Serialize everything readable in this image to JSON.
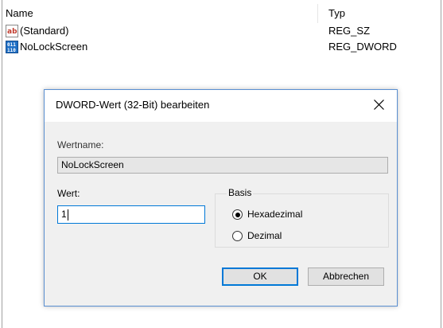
{
  "list": {
    "header_name": "Name",
    "header_type": "Typ",
    "rows": [
      {
        "name": "(Standard)",
        "type": "REG_SZ",
        "icon": "string-value-icon"
      },
      {
        "name": "NoLockScreen",
        "type": "REG_DWORD",
        "icon": "binary-value-icon"
      }
    ]
  },
  "dialog": {
    "title": "DWORD-Wert (32-Bit) bearbeiten",
    "valuename_label": "Wertname:",
    "valuename": "NoLockScreen",
    "value_label": "Wert:",
    "value": "1",
    "base_label": "Basis",
    "hex_label": "Hexadezimal",
    "dec_label": "Dezimal",
    "base_selected": "Hexadezimal",
    "ok_label": "OK",
    "cancel_label": "Abbrechen"
  },
  "colors": {
    "accent": "#0078d7",
    "dialog_bg": "#f0f0f0",
    "string_icon": "#c0392b",
    "binary_icon": "#1f6fc5"
  }
}
